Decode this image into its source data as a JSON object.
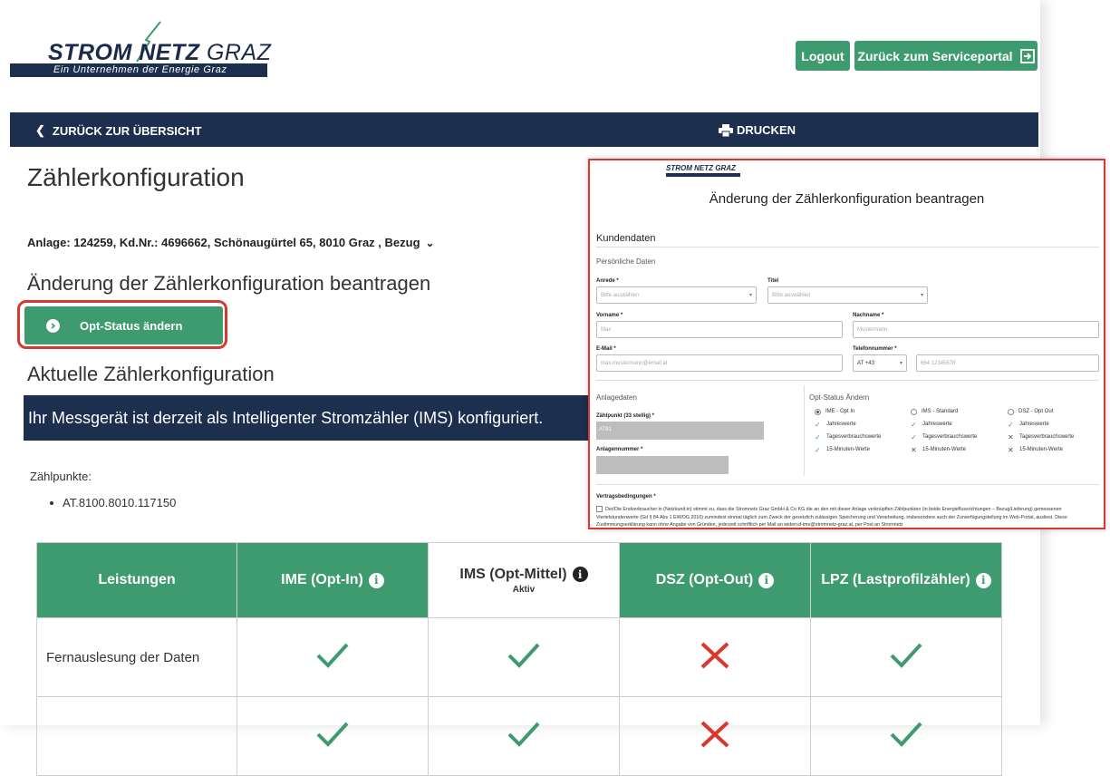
{
  "header": {
    "logo": {
      "word1": "STROM",
      "word2": "NETZ",
      "word3": "GRAZ",
      "tagline": "Ein Unternehmen der Energie Graz"
    },
    "logout_label": "Logout",
    "portal_label": "Zurück zum Serviceportal"
  },
  "nav": {
    "back_label": "ZURÜCK ZUR ÜBERSICHT",
    "print_label": "DRUCKEN"
  },
  "page": {
    "title": "Zählerkonfiguration",
    "anlage": "Anlage: 124259, Kd.Nr.: 4696662, Schönaugürtel 65, 8010 Graz , Bezug",
    "change_heading": "Änderung der Zählerkonfiguration beantragen",
    "opt_button": "Opt-Status ändern",
    "current_heading": "Aktuelle Zählerkonfiguration",
    "banner": "Ihr Messgerät ist derzeit als Intelligenter Stromzähler (IMS) konfiguriert.",
    "zaehlpunkte_label": "Zählpunkte:",
    "zaehlpunkte": [
      "AT.8100.8010.117150"
    ]
  },
  "table": {
    "headers": [
      {
        "label": "Leistungen",
        "info": false,
        "sub": "",
        "active": false
      },
      {
        "label": "IME (Opt-In)",
        "info": true,
        "sub": "",
        "active": false
      },
      {
        "label": "IMS (Opt-Mittel)",
        "info": true,
        "sub": "Aktiv",
        "active": true
      },
      {
        "label": "DSZ (Opt-Out)",
        "info": true,
        "sub": "",
        "active": false
      },
      {
        "label": "LPZ (Lastprofilzähler)",
        "info": true,
        "sub": "",
        "active": false
      }
    ],
    "rows": [
      {
        "label": "Fernauslesung der Daten",
        "values": [
          "check",
          "check",
          "cross",
          "check"
        ]
      },
      {
        "label": "",
        "values": [
          "check",
          "check",
          "cross",
          "check"
        ]
      }
    ],
    "colors": {
      "check": "#3e9a6f",
      "cross": "#d8382e"
    }
  },
  "overlay": {
    "logo_text": "STROM NETZ GRAZ",
    "title": "Änderung der Zählerkonfiguration beantragen",
    "kundendaten": "Kundendaten",
    "persoenliche": "Persönliche Daten",
    "anrede_label": "Anrede *",
    "anrede_ph": "Bitte auswählen",
    "titel_label": "Titel",
    "titel_ph": "Bitte auswählen",
    "vorname_label": "Vorname *",
    "vorname_ph": "Max",
    "nachname_label": "Nachname *",
    "nachname_ph": "Mustermann",
    "email_label": "E-Mail *",
    "email_ph": "max.mustermann@email.at",
    "tel_label": "Telefonnummer *",
    "tel_prefix": "AT +43",
    "tel_ph": "664 12345678",
    "anlagedaten": "Anlagedaten",
    "zaehlpunkt_label": "Zählpunkt (33 stellig) *",
    "zaehlpunkt_value": "AT81",
    "anlagennummer_label": "Anlagennummer *",
    "opt_section": "Opt-Status Ändern",
    "options": [
      {
        "label": "IME - Opt In",
        "selected": true,
        "features": [
          [
            "check",
            "Jahreswerte"
          ],
          [
            "check",
            "Tagesverbrauchswerte"
          ],
          [
            "check",
            "15-Minuten-Werte"
          ]
        ]
      },
      {
        "label": "IMS - Standard",
        "selected": false,
        "features": [
          [
            "check",
            "Jahreswerte"
          ],
          [
            "check",
            "Tagesverbrauchswerte"
          ],
          [
            "cross",
            "15-Minuten-Werte"
          ]
        ]
      },
      {
        "label": "DSZ - Opt Out",
        "selected": false,
        "features": [
          [
            "check",
            "Jahreswerte"
          ],
          [
            "cross",
            "Tagesverbrauchswerte"
          ],
          [
            "cross",
            "15-Minuten-Werte"
          ]
        ]
      }
    ],
    "terms_label": "Vertragsbedingungen *",
    "terms_text": "Der/Die Endverbraucher:in (Netzkund:in) stimmt zu, dass die Stromnetz Graz GmbH & Co KG die an den mit dieser Anlage verknüpften Zählpunkten (in beide Energieflussrichtungen – Bezug/Lieferung) gemessenen Viertelstundenwerte (Gd § 84 Abs 1 ElWOG 2010) zumindest einmal täglich zum Zweck der gesetzlich zulässigen Speicherung und Verarbeitung, insbesondere auch der Zurverfügungstellung im Web-Portal, ausliest. Diese Zustimmungserklärung kann ohne Angabe von Gründen, jederzeit schriftlich per Mail an widerruf-ime@stromnetz-graz.at, per Post an Stromnetz"
  }
}
